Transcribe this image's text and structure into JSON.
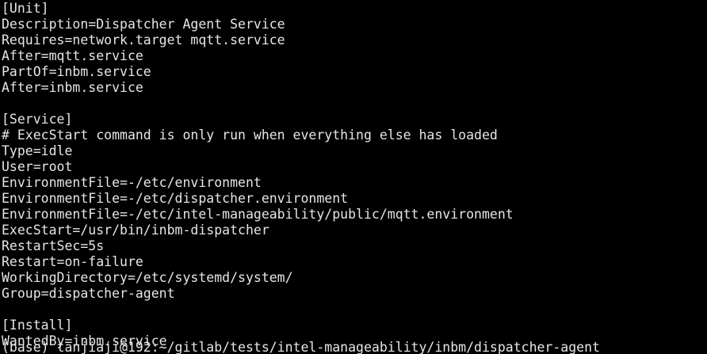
{
  "terminal": {
    "lines": [
      "[Unit]",
      "Description=Dispatcher Agent Service",
      "Requires=network.target mqtt.service",
      "After=mqtt.service",
      "PartOf=inbm.service",
      "After=inbm.service",
      "",
      "[Service]",
      "# ExecStart command is only run when everything else has loaded",
      "Type=idle",
      "User=root",
      "EnvironmentFile=-/etc/environment",
      "EnvironmentFile=-/etc/dispatcher.environment",
      "EnvironmentFile=-/etc/intel-manageability/public/mqtt.environment",
      "ExecStart=/usr/bin/inbm-dispatcher",
      "RestartSec=5s",
      "Restart=on-failure",
      "WorkingDirectory=/etc/systemd/system/",
      "Group=dispatcher-agent",
      "",
      "[Install]",
      "WantedBy=inbm.service",
      "(base) tanjiaji@192:~/gitlab/tests/intel-manageability/inbm/dispatcher-agent"
    ],
    "colors": {
      "background": "#000000",
      "text": "#e6e6e6"
    }
  }
}
